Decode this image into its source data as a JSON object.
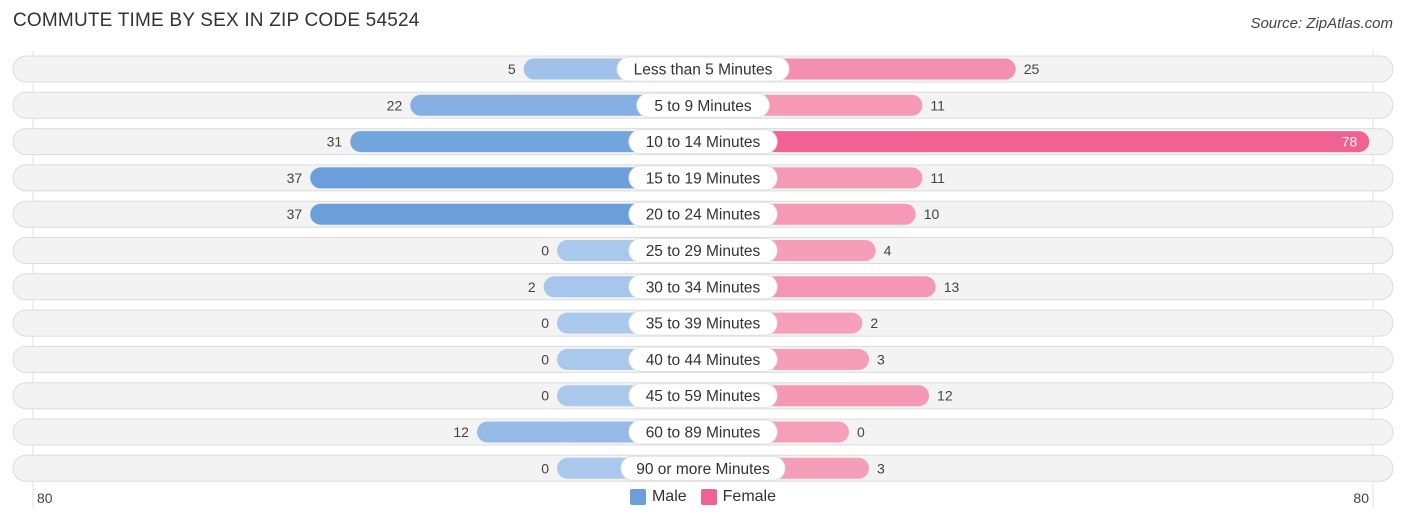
{
  "title": "COMMUTE TIME BY SEX IN ZIP CODE 54524",
  "source": "Source: ZipAtlas.com",
  "colors": {
    "male": "#6a9fdb",
    "male_light": "#a9c8ec",
    "female": "#f06292",
    "female_light": "#f5a0bb"
  },
  "chart_data": {
    "type": "bar",
    "orientation": "horizontal-diverging",
    "title": "COMMUTE TIME BY SEX IN ZIP CODE 54524",
    "categories": [
      "Less than 5 Minutes",
      "5 to 9 Minutes",
      "10 to 14 Minutes",
      "15 to 19 Minutes",
      "20 to 24 Minutes",
      "25 to 29 Minutes",
      "30 to 34 Minutes",
      "35 to 39 Minutes",
      "40 to 44 Minutes",
      "45 to 59 Minutes",
      "60 to 89 Minutes",
      "90 or more Minutes"
    ],
    "series": [
      {
        "name": "Male",
        "values": [
          5,
          22,
          31,
          37,
          37,
          0,
          2,
          0,
          0,
          0,
          12,
          0
        ]
      },
      {
        "name": "Female",
        "values": [
          25,
          11,
          78,
          11,
          10,
          4,
          13,
          2,
          3,
          12,
          0,
          3
        ]
      }
    ],
    "xlim": [
      -80,
      80
    ],
    "axis_labels": {
      "left": "80",
      "right": "80"
    },
    "legend": {
      "position": "bottom-center",
      "entries": [
        "Male",
        "Female"
      ]
    }
  }
}
